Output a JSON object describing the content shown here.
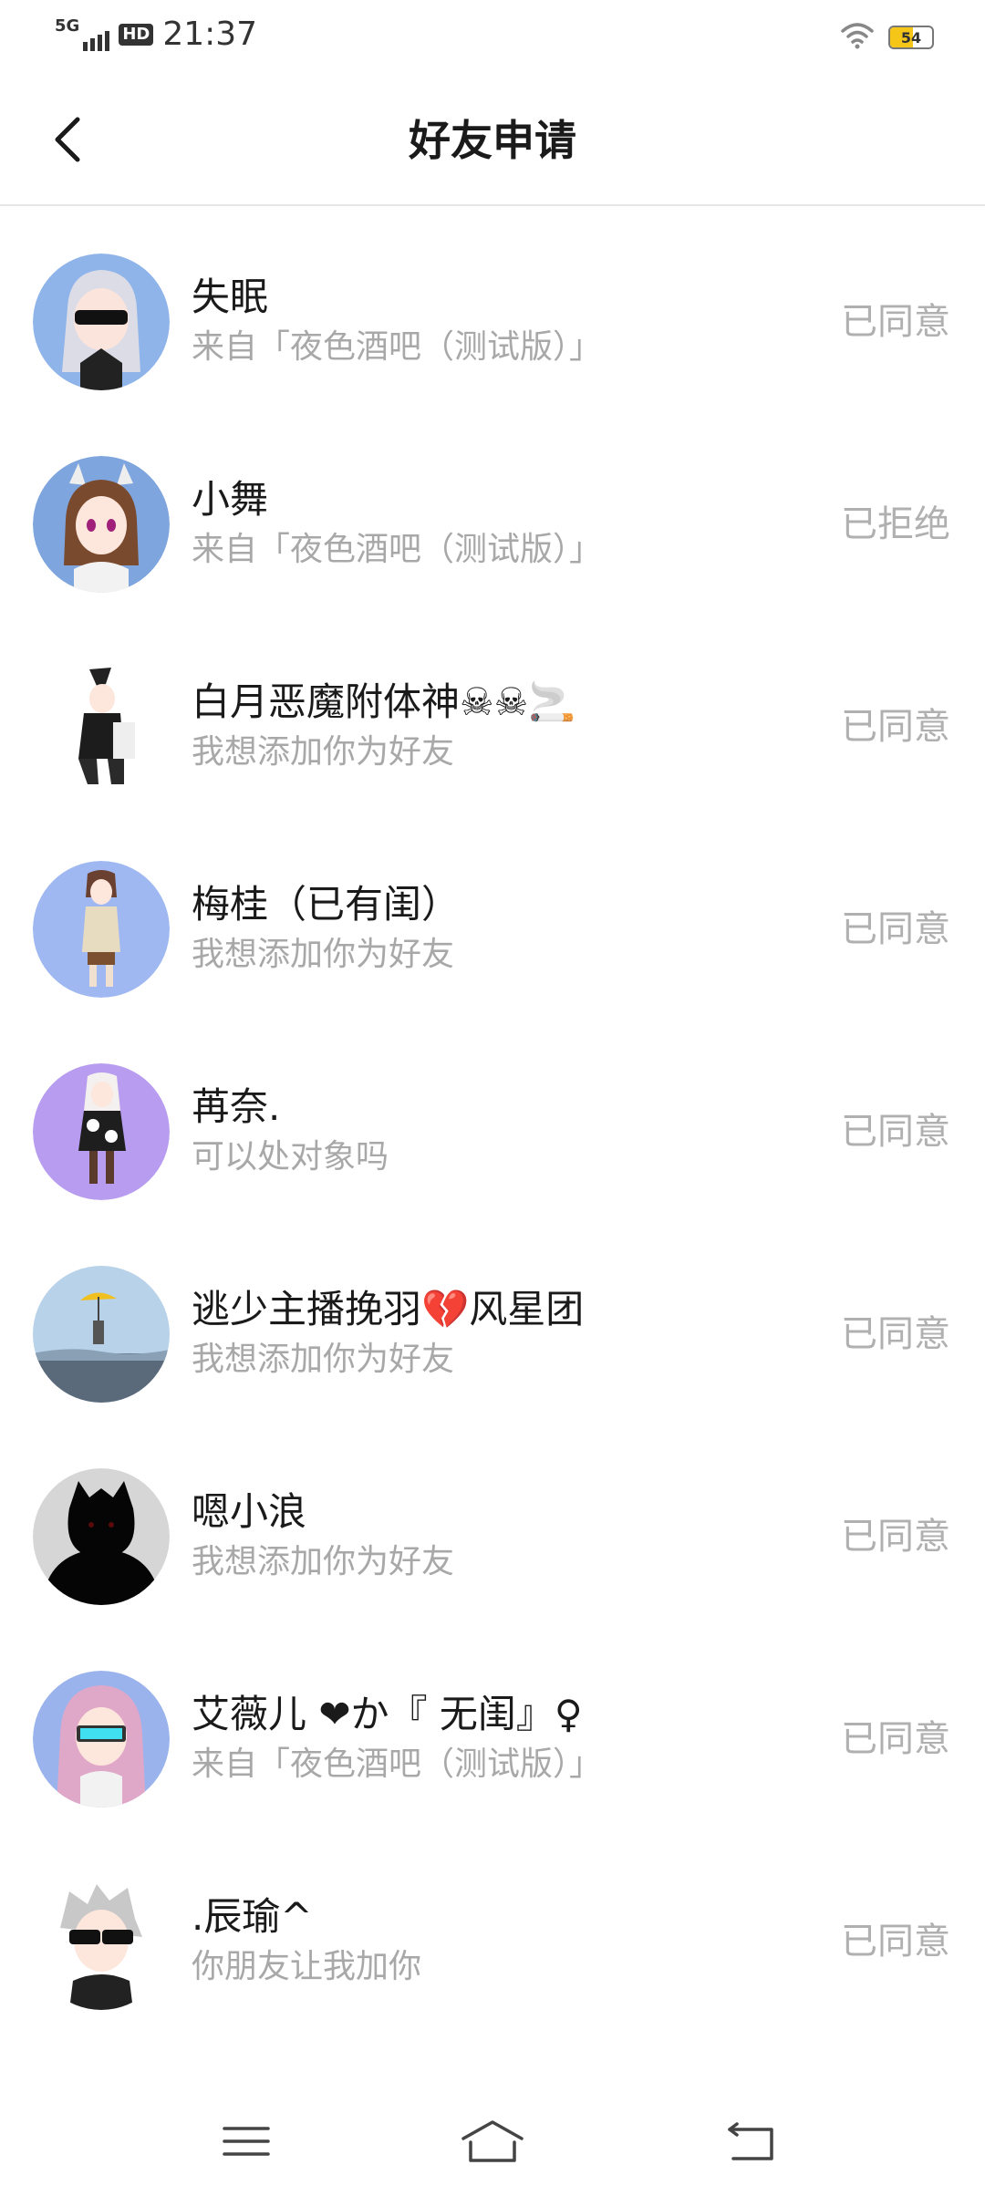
{
  "status_bar": {
    "network": "5G",
    "hd": "HD",
    "time": "21:37",
    "battery_level": 54,
    "battery_text": "54",
    "icons": [
      "signal-icon",
      "hd-icon",
      "wifi-icon",
      "battery-icon"
    ],
    "battery_color": "#f5c518"
  },
  "header": {
    "title": "好友申请",
    "back_icon": "back-arrow-icon"
  },
  "requests": [
    {
      "name": "失眠",
      "subtitle": "来自「夜色酒吧（测试版）」",
      "status": "已同意",
      "avatar_bg": "#8fb4ea"
    },
    {
      "name": "小舞",
      "subtitle": "来自「夜色酒吧（测试版）」",
      "status": "已拒绝",
      "avatar_bg": "#7ea5de"
    },
    {
      "name": "白月恶魔附体神☠☠🚬",
      "subtitle": "我想添加你为好友",
      "status": "已同意",
      "avatar_bg": "#ffffff"
    },
    {
      "name": "梅桂（已有闺）",
      "subtitle": "我想添加你为好友",
      "status": "已同意",
      "avatar_bg": "#9fb8f2"
    },
    {
      "name": "苒奈.",
      "subtitle": "可以处对象吗",
      "status": "已同意",
      "avatar_bg": "#b79cf0"
    },
    {
      "name": "逃少主播挽羽💔风星团",
      "subtitle": "我想添加你为好友",
      "status": "已同意",
      "avatar_bg": "#a9c8e6"
    },
    {
      "name": "嗯小浪",
      "subtitle": "我想添加你为好友",
      "status": "已同意",
      "avatar_bg": "#d6d6d6"
    },
    {
      "name": "艾薇儿 ❤か『 无闺』♀",
      "subtitle": "来自「夜色酒吧（测试版）」",
      "status": "已同意",
      "avatar_bg": "#9ab3ec"
    },
    {
      "name": ".辰瑜^",
      "subtitle": "你朋友让我加你",
      "status": "已同意",
      "avatar_bg": "#ffffff"
    }
  ],
  "nav_bar": {
    "menu_icon": "menu-icon",
    "home_icon": "home-icon",
    "back_icon": "back-icon"
  },
  "colors": {
    "status_text": "#b0b0b0",
    "subtitle_text": "#a8a8a8",
    "title_text": "#1a1a1a",
    "divider": "#e6e6e6"
  }
}
